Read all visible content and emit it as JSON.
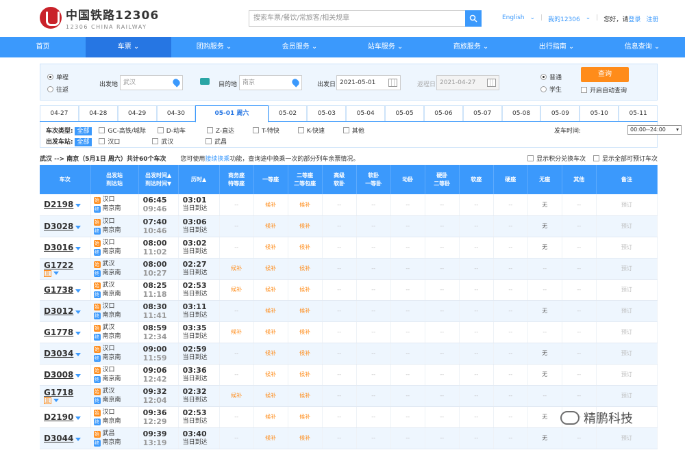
{
  "header": {
    "logo_cn": "中国铁路12306",
    "logo_en": "12306 CHINA RAILWAY",
    "search_placeholder": "搜索车票/餐饮/常旅客/相关规章",
    "lang": "English",
    "my12306": "我的12306",
    "greeting": "您好，请",
    "login": "登录",
    "register": "注册"
  },
  "nav": [
    "首页",
    "车票",
    "团购服务",
    "会员服务",
    "站车服务",
    "商旅服务",
    "出行指南",
    "信息查询"
  ],
  "query": {
    "oneway": "单程",
    "roundtrip": "往返",
    "from_label": "出发地",
    "from_value": "武汉",
    "to_label": "目的地",
    "to_value": "南京",
    "date_label": "出发日",
    "date_value": "2021-05-01",
    "return_label": "返程日",
    "return_value": "2021-04-27",
    "normal": "普通",
    "student": "学生",
    "query_btn": "查询",
    "auto_query": "开启自动查询"
  },
  "dates": [
    "04-27",
    "04-28",
    "04-29",
    "04-30",
    "05-01 周六",
    "05-02",
    "05-03",
    "05-04",
    "05-05",
    "05-06",
    "05-07",
    "05-08",
    "05-09",
    "05-10",
    "05-11"
  ],
  "filter": {
    "type_label": "车次类型:",
    "all": "全部",
    "types": [
      "GC-高铁/城际",
      "D-动车",
      "Z-直达",
      "T-特快",
      "K-快速",
      "其他"
    ],
    "station_label": "出发车站:",
    "stations": [
      "汉口",
      "武汉",
      "武昌"
    ],
    "time_label": "发车时间:",
    "time_value": "00:00--24:00"
  },
  "summary": {
    "route": "武汉 --> 南京（5月1日 周六）共计",
    "count": "60",
    "unit": "个车次",
    "tip_pre": "您可使用",
    "tip_link": "接续换乘",
    "tip_post": "功能，查询途中换乘一次的部分列车余票情况。",
    "opt1": "显示积分兑换车次",
    "opt2": "显示全部可预订车次"
  },
  "columns": [
    "车次",
    "出发站\n到达站",
    "出发时间▲\n到达时间▼",
    "历时▲",
    "商务座\n特等座",
    "一等座",
    "二等座\n二等包座",
    "高级\n软卧",
    "软卧\n一等卧",
    "动卧",
    "硬卧\n二等卧",
    "软座",
    "硬座",
    "无座",
    "其他",
    "备注"
  ],
  "trains": [
    {
      "no": "D2198",
      "fu": "",
      "from": "汉口",
      "to": "南京南",
      "dep": "06:45",
      "arr": "09:46",
      "dur": "03:01",
      "arrday": "当日到达",
      "seats": [
        "--",
        "候补",
        "候补",
        "--",
        "--",
        "--",
        "--",
        "--",
        "--",
        "无",
        "--"
      ],
      "note": "预订"
    },
    {
      "no": "D3028",
      "fu": "",
      "from": "汉口",
      "to": "南京南",
      "dep": "07:40",
      "arr": "10:46",
      "dur": "03:06",
      "arrday": "当日到达",
      "seats": [
        "--",
        "候补",
        "候补",
        "--",
        "--",
        "--",
        "--",
        "--",
        "--",
        "无",
        "--"
      ],
      "note": "预订"
    },
    {
      "no": "D3016",
      "fu": "",
      "from": "汉口",
      "to": "南京南",
      "dep": "08:00",
      "arr": "11:02",
      "dur": "03:02",
      "arrday": "当日到达",
      "seats": [
        "--",
        "候补",
        "候补",
        "--",
        "--",
        "--",
        "--",
        "--",
        "--",
        "无",
        "--"
      ],
      "note": "预订"
    },
    {
      "no": "G1722",
      "fu": "复",
      "from": "武汉",
      "to": "南京南",
      "dep": "08:00",
      "arr": "10:27",
      "dur": "02:27",
      "arrday": "当日到达",
      "seats": [
        "候补",
        "候补",
        "候补",
        "--",
        "--",
        "--",
        "--",
        "--",
        "--",
        "--",
        "--"
      ],
      "note": "预订"
    },
    {
      "no": "G1738",
      "fu": "",
      "from": "武汉",
      "to": "南京南",
      "dep": "08:25",
      "arr": "11:18",
      "dur": "02:53",
      "arrday": "当日到达",
      "seats": [
        "候补",
        "候补",
        "候补",
        "--",
        "--",
        "--",
        "--",
        "--",
        "--",
        "--",
        "--"
      ],
      "note": "预订"
    },
    {
      "no": "D3012",
      "fu": "",
      "from": "汉口",
      "to": "南京南",
      "dep": "08:30",
      "arr": "11:41",
      "dur": "03:11",
      "arrday": "当日到达",
      "seats": [
        "--",
        "候补",
        "候补",
        "--",
        "--",
        "--",
        "--",
        "--",
        "--",
        "无",
        "--"
      ],
      "note": "预订"
    },
    {
      "no": "G1778",
      "fu": "",
      "from": "武汉",
      "to": "南京南",
      "dep": "08:59",
      "arr": "12:34",
      "dur": "03:35",
      "arrday": "当日到达",
      "seats": [
        "候补",
        "候补",
        "候补",
        "--",
        "--",
        "--",
        "--",
        "--",
        "--",
        "--",
        "--"
      ],
      "note": "预订"
    },
    {
      "no": "D3034",
      "fu": "",
      "from": "汉口",
      "to": "南京南",
      "dep": "09:00",
      "arr": "11:59",
      "dur": "02:59",
      "arrday": "当日到达",
      "seats": [
        "--",
        "候补",
        "候补",
        "--",
        "--",
        "--",
        "--",
        "--",
        "--",
        "无",
        "--"
      ],
      "note": "预订"
    },
    {
      "no": "D3008",
      "fu": "",
      "from": "汉口",
      "to": "南京南",
      "dep": "09:06",
      "arr": "12:42",
      "dur": "03:36",
      "arrday": "当日到达",
      "seats": [
        "--",
        "候补",
        "候补",
        "--",
        "--",
        "--",
        "--",
        "--",
        "--",
        "无",
        "--"
      ],
      "note": "预订"
    },
    {
      "no": "G1718",
      "fu": "复",
      "from": "武汉",
      "to": "南京南",
      "dep": "09:32",
      "arr": "12:04",
      "dur": "02:32",
      "arrday": "当日到达",
      "seats": [
        "候补",
        "候补",
        "候补",
        "--",
        "--",
        "--",
        "--",
        "--",
        "--",
        "--",
        "--"
      ],
      "note": "预订"
    },
    {
      "no": "D2190",
      "fu": "",
      "from": "汉口",
      "to": "南京南",
      "dep": "09:36",
      "arr": "12:29",
      "dur": "02:53",
      "arrday": "当日到达",
      "seats": [
        "--",
        "候补",
        "候补",
        "--",
        "--",
        "--",
        "--",
        "--",
        "--",
        "无",
        "--"
      ],
      "note": "预订"
    },
    {
      "no": "D3044",
      "fu": "",
      "from": "武昌",
      "to": "南京南",
      "dep": "09:39",
      "arr": "13:19",
      "dur": "03:40",
      "arrday": "当日到达",
      "seats": [
        "--",
        "候补",
        "候补",
        "--",
        "--",
        "--",
        "--",
        "--",
        "--",
        "无",
        "--"
      ],
      "note": "预订"
    }
  ],
  "station_badges": {
    "start": "始",
    "end": "终"
  },
  "watermark": "精鹏科技",
  "colors": {
    "brand_blue": "#3b99fc",
    "accent_orange": "#ff8c1a",
    "logo_red": "#c9222a"
  }
}
